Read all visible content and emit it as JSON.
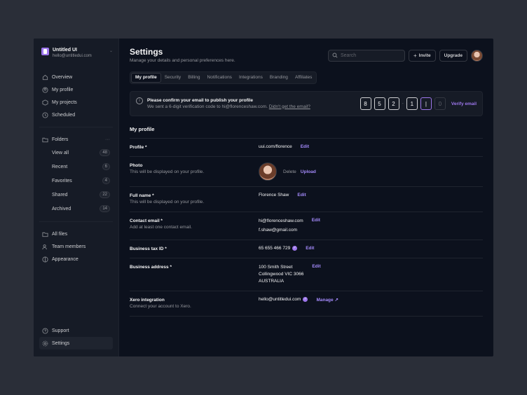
{
  "brand": {
    "name": "Untitled UI",
    "email": "hello@untitledui.com",
    "accent": "#9e77ed"
  },
  "nav": [
    {
      "label": "Overview",
      "icon": "home-icon"
    },
    {
      "label": "My profile",
      "icon": "user-icon"
    },
    {
      "label": "My projects",
      "icon": "cube-icon"
    },
    {
      "label": "Scheduled",
      "icon": "clock-icon"
    }
  ],
  "folders": {
    "label": "Folders",
    "items": [
      {
        "label": "View all",
        "count": "48"
      },
      {
        "label": "Recent",
        "count": "6"
      },
      {
        "label": "Favorites",
        "count": "4"
      },
      {
        "label": "Shared",
        "count": "22"
      },
      {
        "label": "Archived",
        "count": "14"
      }
    ]
  },
  "nav2": [
    {
      "label": "All files",
      "icon": "files-icon"
    },
    {
      "label": "Team members",
      "icon": "users-icon"
    },
    {
      "label": "Appearance",
      "icon": "contrast-icon"
    }
  ],
  "bottom": [
    {
      "label": "Support",
      "icon": "help-icon"
    },
    {
      "label": "Settings",
      "icon": "gear-icon"
    }
  ],
  "header": {
    "title": "Settings",
    "subtitle": "Manage your details and personal preferences here.",
    "search_placeholder": "Search",
    "invite": "Invite",
    "upgrade": "Upgrade"
  },
  "tabs": [
    "My profile",
    "Security",
    "Billing",
    "Notifications",
    "Integrations",
    "Branding",
    "Affiliates"
  ],
  "alert": {
    "title": "Please confirm your email to publish your profile",
    "desc": "We sent a 6-digit verification code to hi@florenceshaw.com.",
    "link": "Didn't get the email?",
    "digits": [
      "8",
      "5",
      "2",
      "1",
      "",
      "0"
    ],
    "verify": "Verify email"
  },
  "profile": {
    "section_title": "My profile",
    "profile_label": "Profile *",
    "profile_value": "uui.com/florence",
    "edit": "Edit",
    "photo_label": "Photo",
    "photo_hint": "This will be displayed on your profile.",
    "delete": "Delete",
    "upload": "Upload",
    "fullname_label": "Full name *",
    "fullname_hint": "This will be displayed on your profile.",
    "fullname_value": "Florence Shaw",
    "contact_label": "Contact email *",
    "contact_hint": "Add at least one contact email.",
    "contact_1": "hi@florenceshaw.com",
    "contact_2": "f.shaw@gmail.com",
    "tax_label": "Business tax ID *",
    "tax_value": "65 655 466 729",
    "address_label": "Business address *",
    "address_1": "100 Smith Street",
    "address_2": "Collingwood VIC 3066",
    "address_3": "AUSTRALIA",
    "xero_label": "Xero integration",
    "xero_hint": "Connect your account to Xero.",
    "xero_value": "hello@untitledui.com",
    "manage": "Manage ↗"
  }
}
